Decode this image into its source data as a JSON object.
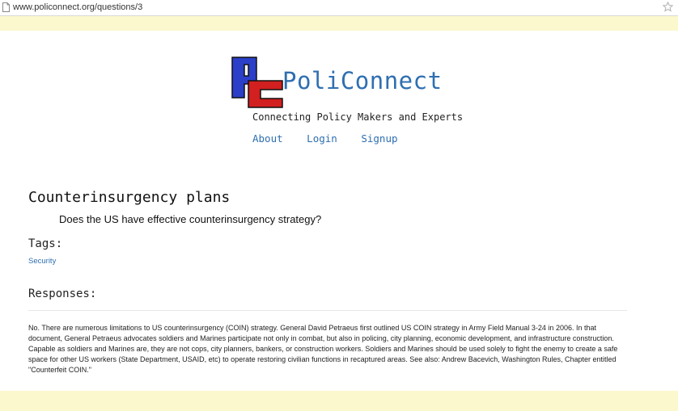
{
  "browser": {
    "url": "www.policonnect.org/questions/3",
    "page_icon": "document-icon",
    "bookmark_icon": "star-icon"
  },
  "colors": {
    "band": "#fbf8cd",
    "link": "#2f6fb0",
    "logo_blue": "#2b3fc9",
    "logo_red": "#d21f1f"
  },
  "header": {
    "logo_icon": "pc-logo-icon",
    "site_name": "PoliConnect",
    "tagline": "Connecting Policy Makers and Experts",
    "nav": [
      {
        "label": "About"
      },
      {
        "label": "Login"
      },
      {
        "label": "Signup"
      }
    ]
  },
  "question": {
    "title": "Counterinsurgency plans",
    "body": "Does the US have effective counterinsurgency strategy?",
    "tags_heading": "Tags:",
    "tags": [
      "Security"
    ],
    "responses_heading": "Responses:",
    "responses": [
      {
        "text": "No. There are numerous limitations to US counterinsurgency (COIN) strategy. General David Petraeus first outlined US COIN strategy in Army Field Manual 3-24 in 2006. In that document, General Petraeus advocates soldiers and Marines participate not only in combat, but also in policing, city planning, economic development, and infrastructure construction. Capable as soldiers and Marines are, they are not cops, city planners, bankers, or construction workers. Soldiers and Marines should be used solely to fight the enemy to create a safe space for other US workers (State Department, USAID, etc) to operate restoring civilian functions in recaptured areas. See also: Andrew Bacevich, Washington Rules, Chapter entitled \"Counterfeit COIN.\""
      }
    ]
  }
}
